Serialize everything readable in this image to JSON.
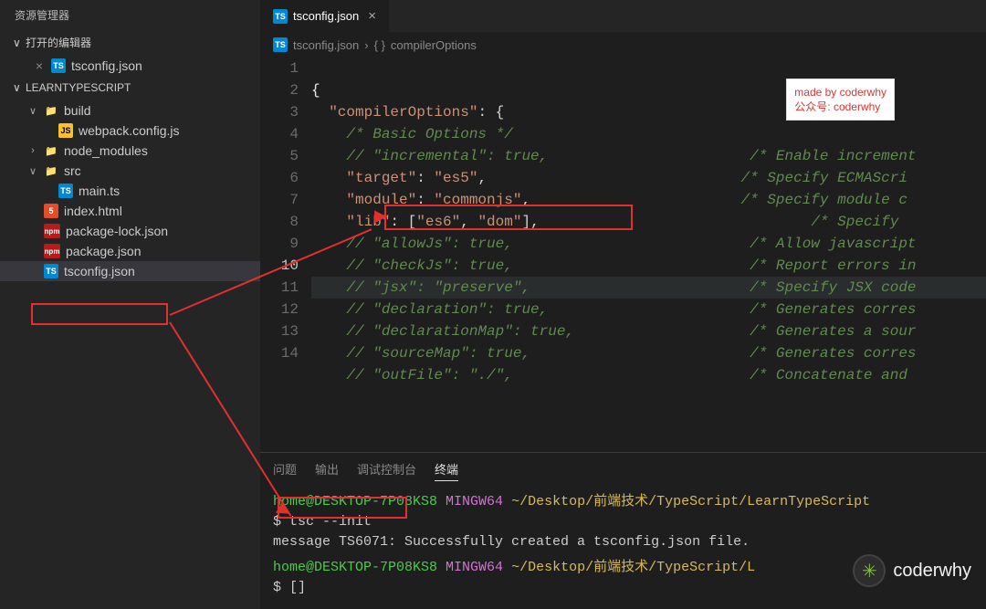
{
  "sidebar": {
    "title": "资源管理器",
    "open_editors_label": "打开的编辑器",
    "open_file": "tsconfig.json",
    "project_label": "LEARNTYPESCRIPT",
    "tree": {
      "build": "build",
      "webpack": "webpack.config.js",
      "node_modules": "node_modules",
      "src": "src",
      "main_ts": "main.ts",
      "index_html": "index.html",
      "pkg_lock": "package-lock.json",
      "pkg": "package.json",
      "tsconfig": "tsconfig.json"
    }
  },
  "tab": {
    "label": "tsconfig.json"
  },
  "breadcrumb": {
    "file": "tsconfig.json",
    "sym": "compilerOptions"
  },
  "code": {
    "line1": "{",
    "l2_key": "\"compilerOptions\"",
    "l2_after": ": {",
    "l3": "/* Basic Options */",
    "l4_a": "// \"incremental\": true,",
    "l4_c": "/* Enable increment",
    "l5_k": "\"target\"",
    "l5_v": "\"es5\"",
    "l5_c": "/* Specify ECMAScri",
    "l6_k": "\"module\"",
    "l6_v": "\"commonjs\"",
    "l6_c": "/* Specify module c",
    "l7_k": "\"lib\"",
    "l7_v1": "\"es6\"",
    "l7_v2": "\"dom\"",
    "l7_c": "/* Specify",
    "l8_a": "// \"allowJs\": true,",
    "l8_c": "/* Allow javascript",
    "l9_a": "// \"checkJs\": true,",
    "l9_c": "/* Report errors in",
    "l10_a": "// \"jsx\": \"preserve\",",
    "l10_c": "/* Specify JSX code",
    "l11_a": "// \"declaration\": true,",
    "l11_c": "/* Generates corres",
    "l12_a": "// \"declarationMap\": true,",
    "l12_c": "/* Generates a sour",
    "l13_a": "// \"sourceMap\": true,",
    "l13_c": "/* Generates corres",
    "l14_a": "// \"outFile\": \"./\",",
    "l14_c": "/* Concatenate and "
  },
  "terminal": {
    "tabs": {
      "problems": "问题",
      "output": "输出",
      "debug": "调试控制台",
      "terminal": "终端"
    },
    "user": "home@DESKTOP-7P08KS8",
    "sys": "MINGW64",
    "path": "~/Desktop/前端技术/TypeScript/LearnTypeScript",
    "path2": "~/Desktop/前端技术/TypeScript/L",
    "prompt": "$",
    "cmd": "tsc --init",
    "msg": "message TS6071: Successfully created a tsconfig.json file.",
    "cursor": "[]"
  },
  "note": {
    "l1": "made by coderwhy",
    "l2": "公众号: coderwhy"
  },
  "watermark": "coderwhy",
  "gutters": [
    "1",
    "2",
    "3",
    "4",
    "5",
    "6",
    "7",
    "8",
    "9",
    "10",
    "11",
    "12",
    "13",
    "14"
  ]
}
